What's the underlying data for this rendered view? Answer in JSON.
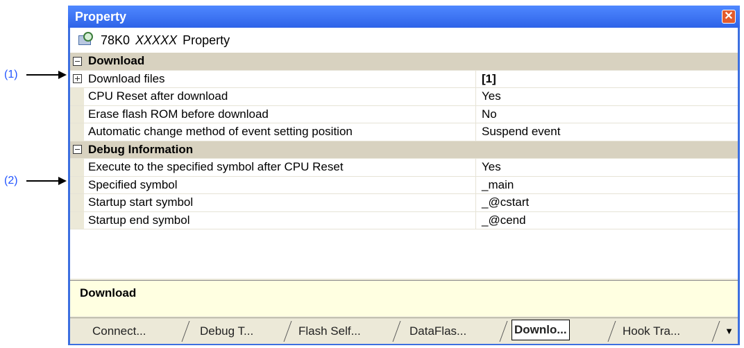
{
  "callouts": [
    {
      "label": "(1)"
    },
    {
      "label": "(2)"
    }
  ],
  "window": {
    "title": "Property",
    "close_glyph": "✕",
    "header": {
      "name": "78K0",
      "model": "XXXXX",
      "suffix": "Property"
    }
  },
  "grid": {
    "download": {
      "label": "Download",
      "rows": [
        {
          "name": "Download files",
          "value": "[1]"
        },
        {
          "name": "CPU Reset after download",
          "value": "Yes"
        },
        {
          "name": "Erase flash ROM before download",
          "value": "No"
        },
        {
          "name": "Automatic change method of event setting position",
          "value": "Suspend event"
        }
      ]
    },
    "debug": {
      "label": "Debug Information",
      "rows": [
        {
          "name": "Execute to the specified symbol after CPU Reset",
          "value": "Yes"
        },
        {
          "name": "Specified symbol",
          "value": "_main"
        },
        {
          "name": "Startup start symbol",
          "value": "_@cstart"
        },
        {
          "name": "Startup end symbol",
          "value": "_@cend"
        }
      ]
    }
  },
  "description": "Download",
  "tabs": [
    {
      "label": "Connect..."
    },
    {
      "label": "Debug T..."
    },
    {
      "label": "Flash Self..."
    },
    {
      "label": "DataFlas..."
    },
    {
      "label": "Downlo..."
    },
    {
      "label": "Hook Tra..."
    }
  ],
  "more_glyph": "▼"
}
